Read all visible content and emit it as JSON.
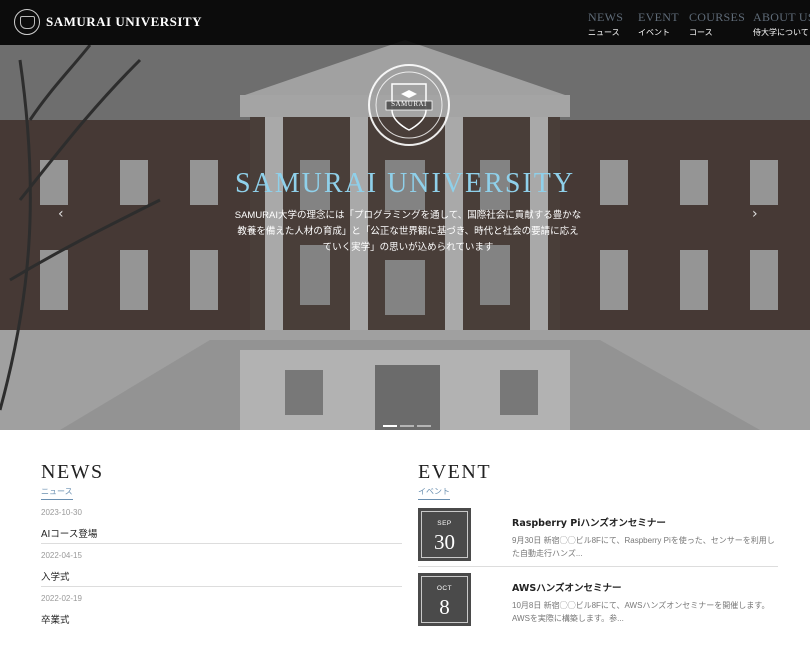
{
  "header": {
    "logo_text": "SAMURAI UNIVERSITY",
    "nav": [
      {
        "en": "NEWS",
        "ja": "ニュース"
      },
      {
        "en": "EVENT",
        "ja": "イベント"
      },
      {
        "en": "COURSES",
        "ja": "コース"
      },
      {
        "en": "ABOUT US",
        "ja": "侍大学について"
      }
    ]
  },
  "hero": {
    "crest_text": "SAMURAI",
    "title": "SAMURAI UNIVERSITY",
    "text_line1": "SAMURAI大学の理念には「プログラミングを通して、国際社会に貢献する豊かな",
    "text_line2": "教養を備えた人材の育成」と「公正な世界観に基づき、時代と社会の要請に応え",
    "text_line3": "ていく実学」の思いが込められています",
    "prev_icon": "‹",
    "next_icon": "›",
    "slides": 3,
    "active_slide": 0
  },
  "news": {
    "title": "NEWS",
    "subtitle": "ニュース",
    "items": [
      {
        "date": "2023-10-30",
        "title": "AIコース登場"
      },
      {
        "date": "2022-04-15",
        "title": "入学式"
      },
      {
        "date": "2022-02-19",
        "title": "卒業式"
      }
    ]
  },
  "event": {
    "title": "EVENT",
    "subtitle": "イベント",
    "items": [
      {
        "month": "SEP",
        "day": "30",
        "title": "Raspberry Piハンズオンセミナー",
        "desc": "9月30日 新宿◯◯ビル8Fにて、Raspberry Piを使った、センサーを利用した自動走行ハンズ..."
      },
      {
        "month": "OCT",
        "day": "8",
        "title": "AWSハンズオンセミナー",
        "desc": "10月8日 新宿◯◯ビル8Fにて、AWSハンズオンセミナーを開催します。AWSを実際に構築します。参..."
      }
    ]
  },
  "colors": {
    "header_bg": "#000000",
    "nav_en": "#5f6b78",
    "hero_title": "#8fd0ea",
    "date_box": "#4a4a4a",
    "subtitle_accent": "#6a8fb0"
  }
}
